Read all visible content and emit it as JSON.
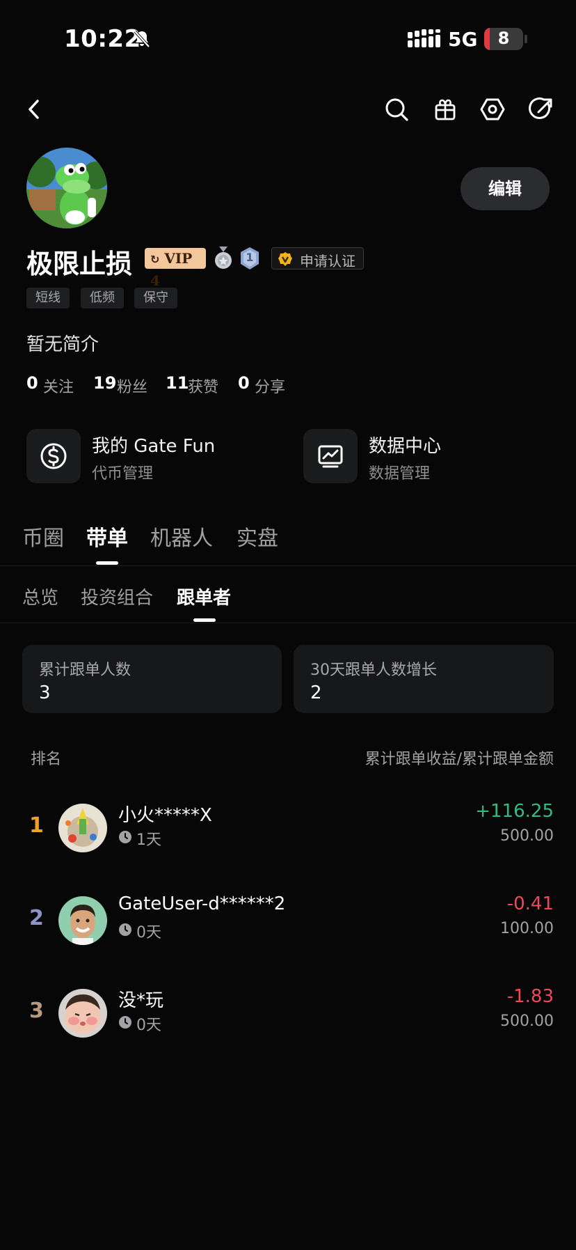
{
  "status_bar": {
    "time": "10:22",
    "network": "5G",
    "battery": "8"
  },
  "profile": {
    "edit_label": "编辑",
    "username": "极限止损",
    "vip_label": "VIP 4",
    "medal_level": "1",
    "verify_label": "申请认证",
    "tags": [
      "短线",
      "低频",
      "保守"
    ],
    "bio": "暂无简介",
    "stats": [
      {
        "num": "0",
        "label": "关注"
      },
      {
        "num": "19",
        "label": "粉丝"
      },
      {
        "num": "11",
        "label": "获赞"
      },
      {
        "num": "0",
        "label": "分享"
      }
    ]
  },
  "tools": [
    {
      "title": "我的 Gate Fun",
      "sub": "代币管理",
      "icon": "dollar-circle-icon"
    },
    {
      "title": "数据中心",
      "sub": "数据管理",
      "icon": "chart-monitor-icon"
    }
  ],
  "main_tabs": [
    "币圈",
    "带单",
    "机器人",
    "实盘"
  ],
  "main_tab_active": "带单",
  "sub_tabs": [
    "总览",
    "投资组合",
    "跟单者"
  ],
  "sub_tab_active": "跟单者",
  "cards": [
    {
      "label": "累计跟单人数",
      "value": "3"
    },
    {
      "label": "30天跟单人数增长",
      "value": "2"
    }
  ],
  "table": {
    "header_left": "排名",
    "header_right": "累计跟单收益/累计跟单金额",
    "rows": [
      {
        "rank": "1",
        "name": "小火*****X",
        "days": "1天",
        "pnl": "+116.25",
        "amount": "500.00",
        "rank_color": "#f0a020",
        "pnl_color": "#2ebd85"
      },
      {
        "rank": "2",
        "name": "GateUser-d******2",
        "days": "0天",
        "pnl": "-0.41",
        "amount": "100.00",
        "rank_color": "#8e93c9",
        "pnl_color": "#f0475a"
      },
      {
        "rank": "3",
        "name": "没*玩",
        "days": "0天",
        "pnl": "-1.83",
        "amount": "500.00",
        "rank_color": "#b59a7d",
        "pnl_color": "#f0475a"
      }
    ]
  }
}
